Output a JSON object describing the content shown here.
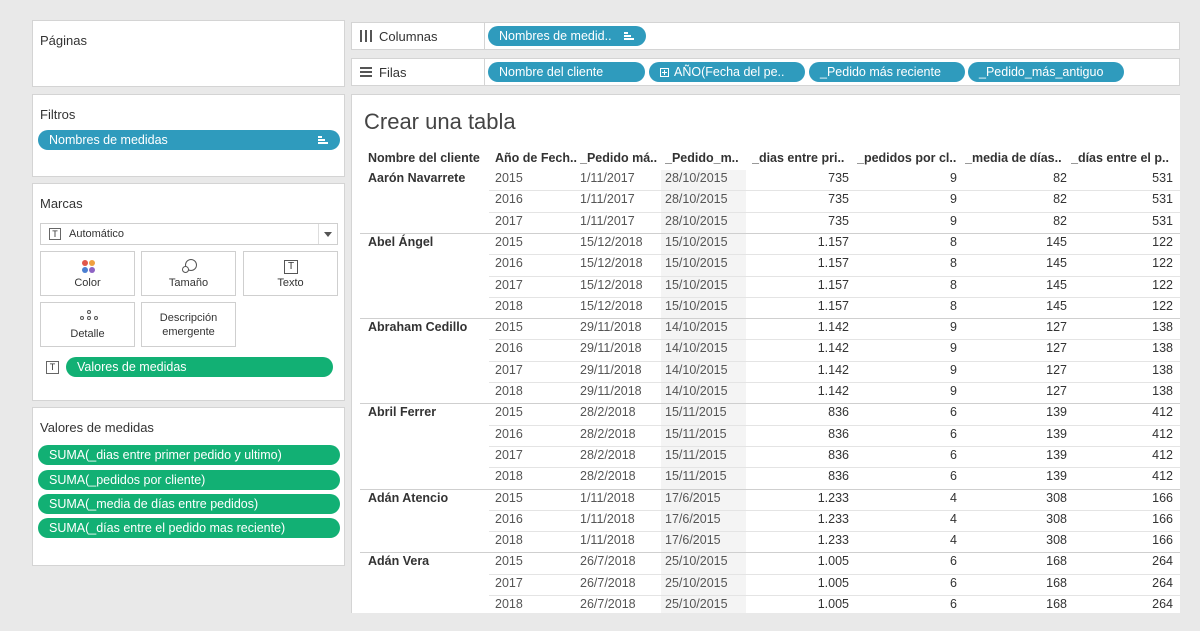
{
  "paginas": {
    "title": "Páginas"
  },
  "filtros": {
    "title": "Filtros",
    "pill": "Nombres de medidas"
  },
  "marcas": {
    "title": "Marcas",
    "dropdown": "Automático",
    "buttons": {
      "color": "Color",
      "tamano": "Tamaño",
      "texto": "Texto",
      "detalle": "Detalle",
      "descripcion": "Descripción emergente"
    },
    "pill": "Valores de medidas",
    "colors": {
      "dot_red": "#e0564b",
      "dot_orange": "#f0a040",
      "dot_blue": "#4b7fd1",
      "dot_purple": "#8e63c4"
    }
  },
  "valores": {
    "title": "Valores de medidas",
    "pills": [
      "SUMA(_dias entre primer pedido y ultimo)",
      "SUMA(_pedidos por cliente)",
      "SUMA(_media de días entre pedidos)",
      "SUMA(_días entre el pedido mas reciente)"
    ]
  },
  "columnas": {
    "label": "Columnas",
    "pills": [
      "Nombres de medid.."
    ]
  },
  "filas": {
    "label": "Filas",
    "pills": [
      "Nombre del cliente",
      "AÑO(Fecha del pe..",
      "_Pedido más reciente",
      "_Pedido_más_antiguo"
    ]
  },
  "view": {
    "title": "Crear una tabla",
    "headers": [
      "Nombre del cliente",
      "Año de Fech..",
      "_Pedido má..",
      "_Pedido_m..",
      "_dias entre pri..",
      "_pedidos por cl..",
      "_media de días..",
      "_días entre el p.."
    ],
    "groups": [
      {
        "customer": "Aarón Navarrete",
        "rows": [
          [
            "2015",
            "1/11/2017",
            "28/10/2015",
            "735",
            "9",
            "82",
            "531"
          ],
          [
            "2016",
            "1/11/2017",
            "28/10/2015",
            "735",
            "9",
            "82",
            "531"
          ],
          [
            "2017",
            "1/11/2017",
            "28/10/2015",
            "735",
            "9",
            "82",
            "531"
          ]
        ]
      },
      {
        "customer": "Abel Ángel",
        "rows": [
          [
            "2015",
            "15/12/2018",
            "15/10/2015",
            "1.157",
            "8",
            "145",
            "122"
          ],
          [
            "2016",
            "15/12/2018",
            "15/10/2015",
            "1.157",
            "8",
            "145",
            "122"
          ],
          [
            "2017",
            "15/12/2018",
            "15/10/2015",
            "1.157",
            "8",
            "145",
            "122"
          ],
          [
            "2018",
            "15/12/2018",
            "15/10/2015",
            "1.157",
            "8",
            "145",
            "122"
          ]
        ]
      },
      {
        "customer": "Abraham Cedillo",
        "rows": [
          [
            "2015",
            "29/11/2018",
            "14/10/2015",
            "1.142",
            "9",
            "127",
            "138"
          ],
          [
            "2016",
            "29/11/2018",
            "14/10/2015",
            "1.142",
            "9",
            "127",
            "138"
          ],
          [
            "2017",
            "29/11/2018",
            "14/10/2015",
            "1.142",
            "9",
            "127",
            "138"
          ],
          [
            "2018",
            "29/11/2018",
            "14/10/2015",
            "1.142",
            "9",
            "127",
            "138"
          ]
        ]
      },
      {
        "customer": "Abril Ferrer",
        "rows": [
          [
            "2015",
            "28/2/2018",
            "15/11/2015",
            "836",
            "6",
            "139",
            "412"
          ],
          [
            "2016",
            "28/2/2018",
            "15/11/2015",
            "836",
            "6",
            "139",
            "412"
          ],
          [
            "2017",
            "28/2/2018",
            "15/11/2015",
            "836",
            "6",
            "139",
            "412"
          ],
          [
            "2018",
            "28/2/2018",
            "15/11/2015",
            "836",
            "6",
            "139",
            "412"
          ]
        ]
      },
      {
        "customer": "Adán Atencio",
        "rows": [
          [
            "2015",
            "1/11/2018",
            "17/6/2015",
            "1.233",
            "4",
            "308",
            "166"
          ],
          [
            "2016",
            "1/11/2018",
            "17/6/2015",
            "1.233",
            "4",
            "308",
            "166"
          ],
          [
            "2018",
            "1/11/2018",
            "17/6/2015",
            "1.233",
            "4",
            "308",
            "166"
          ]
        ]
      },
      {
        "customer": "Adán Vera",
        "rows": [
          [
            "2015",
            "26/7/2018",
            "25/10/2015",
            "1.005",
            "6",
            "168",
            "264"
          ],
          [
            "2017",
            "26/7/2018",
            "25/10/2015",
            "1.005",
            "6",
            "168",
            "264"
          ],
          [
            "2018",
            "26/7/2018",
            "25/10/2015",
            "1.005",
            "6",
            "168",
            "264"
          ]
        ]
      }
    ]
  },
  "colors": {
    "pill_blue": "#2f9bbd",
    "pill_green": "#12b074"
  }
}
